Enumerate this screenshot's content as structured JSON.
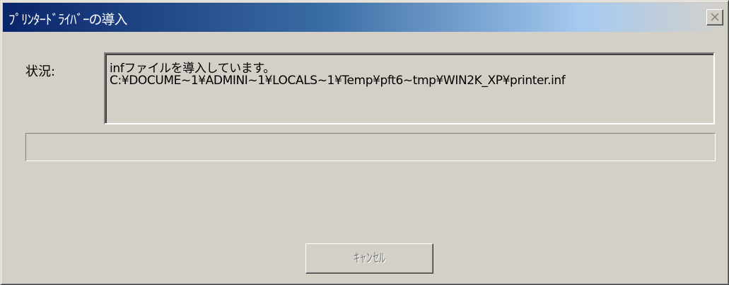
{
  "window": {
    "title": "ﾌﾟﾘﾝﾀｰﾄﾞﾗｲﾊﾞｰの導入",
    "close_glyph": "×"
  },
  "status": {
    "label": "状況:",
    "line1": "infファイルを導入しています。",
    "line2": "C:¥DOCUME~1¥ADMINI~1¥LOCALS~1¥Temp¥pft6~tmp¥WIN2K_XP¥printer.inf"
  },
  "progress": {
    "fraction": 0
  },
  "buttons": {
    "cancel_label": "ｷｬﾝｾﾙ",
    "cancel_enabled": false
  },
  "colors": {
    "dialog_face": "#d4d0c8",
    "title_active_start": "#0a246a",
    "title_active_end": "#a6caf0",
    "disabled_text": "#808080"
  }
}
